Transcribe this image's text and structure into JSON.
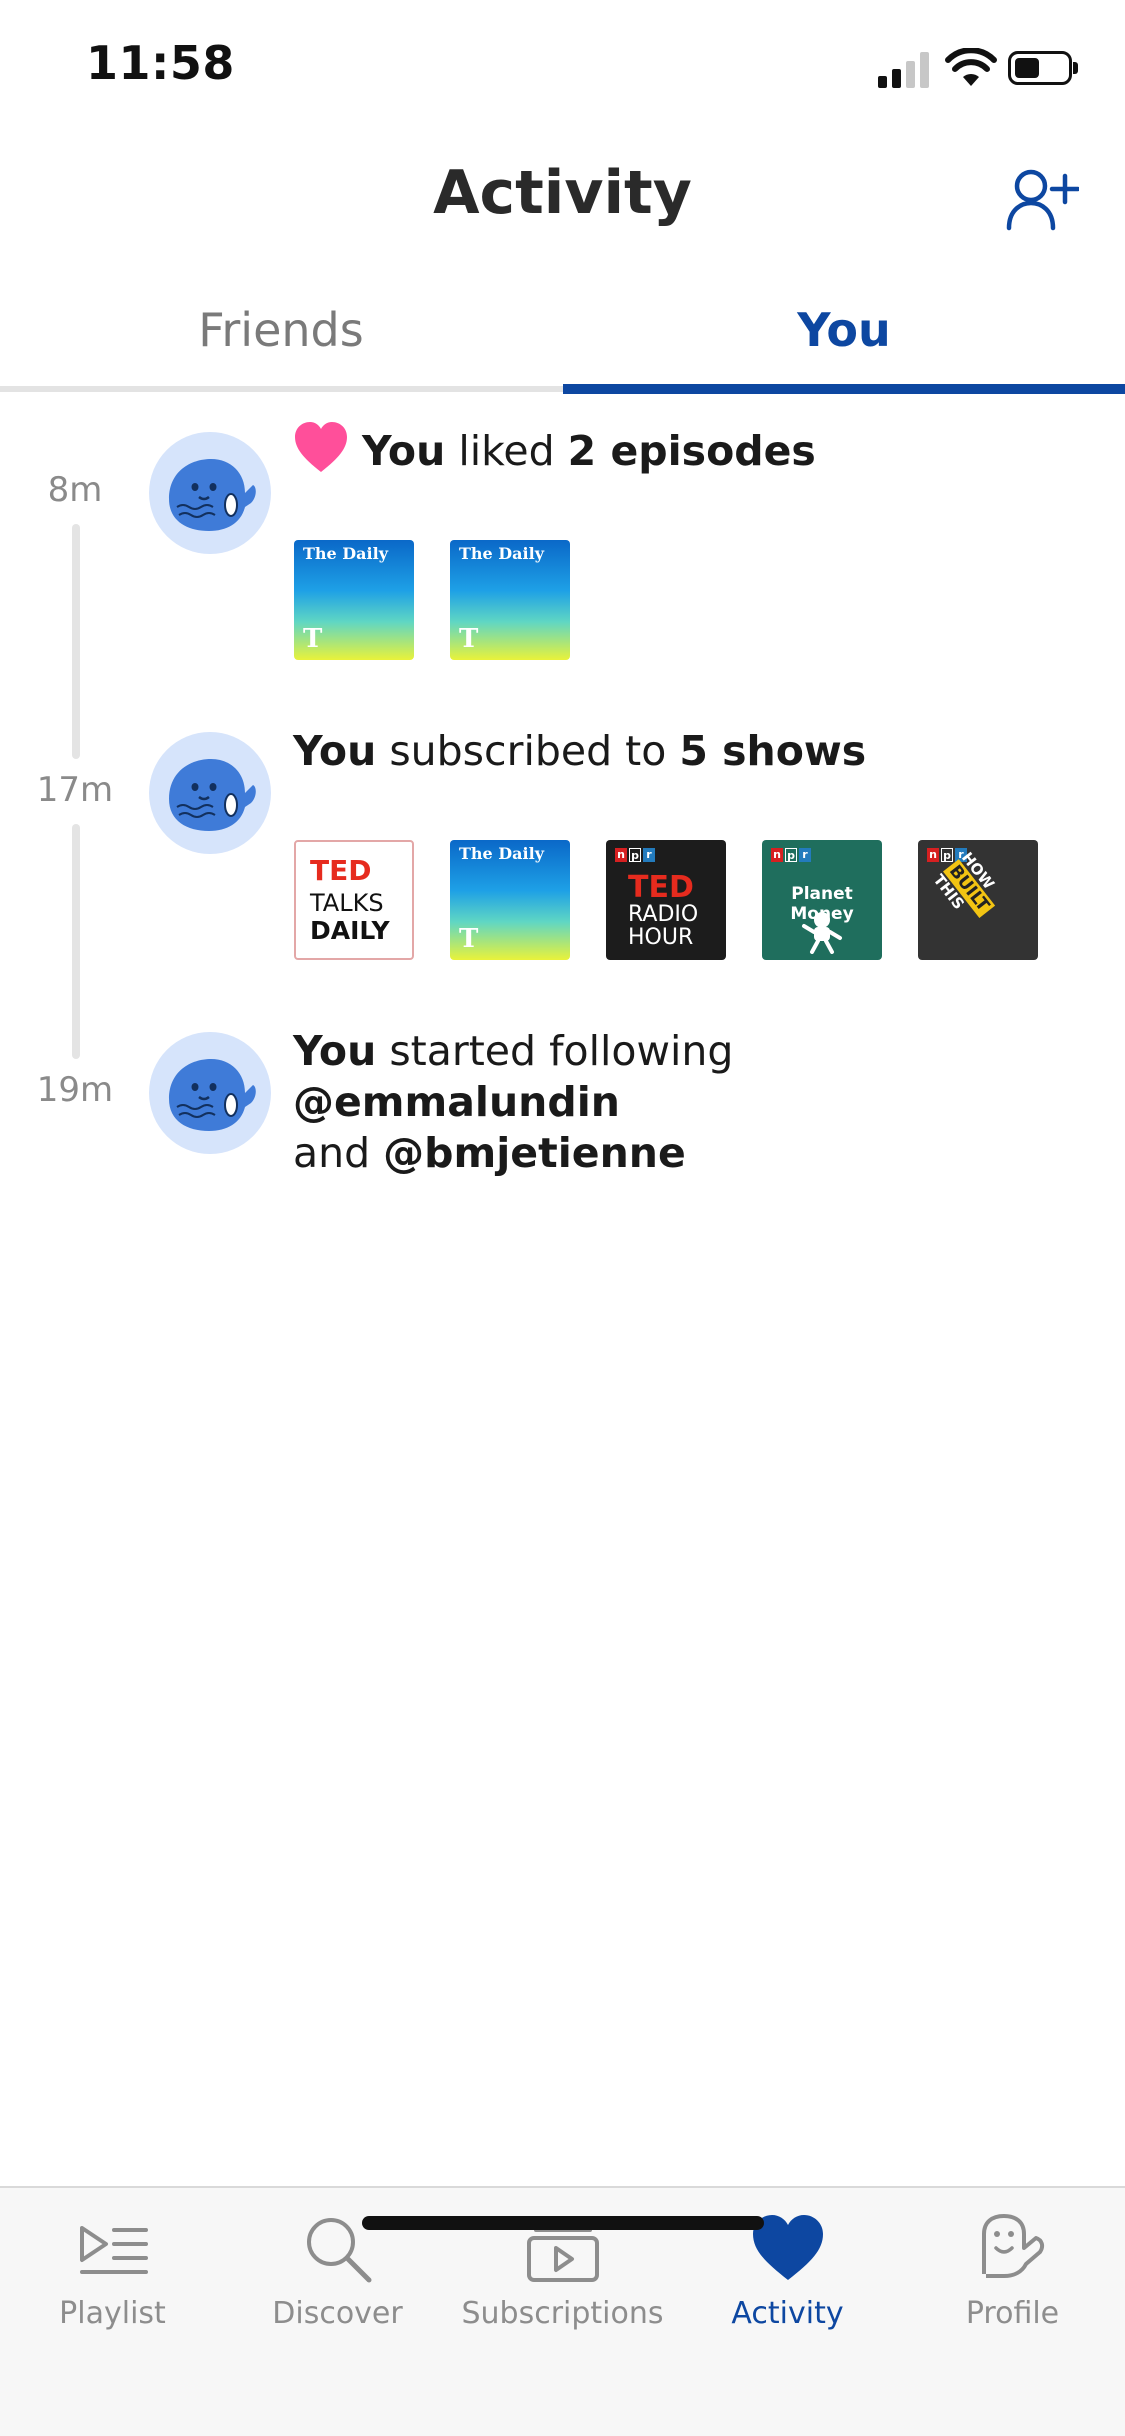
{
  "status_bar": {
    "time": "11:58"
  },
  "header": {
    "title": "Activity"
  },
  "tabs": [
    {
      "label": "Friends",
      "active": false
    },
    {
      "label": "You",
      "active": true
    }
  ],
  "feed": [
    {
      "time": "8m",
      "parts": {
        "subject": "You",
        "verb": " liked ",
        "object": "2 episodes"
      },
      "thumbnails": [
        {
          "show": "The Daily",
          "label": "The Daily",
          "logo": "T"
        },
        {
          "show": "The Daily",
          "label": "The Daily",
          "logo": "T"
        }
      ]
    },
    {
      "time": "17m",
      "parts": {
        "subject": "You",
        "verb": " subscribed to ",
        "object": "5 shows"
      },
      "thumbnails": [
        {
          "show": "TED Talks Daily",
          "l1": "TED",
          "l2": "TALKS",
          "l3": "DAILY"
        },
        {
          "show": "The Daily",
          "label": "The Daily",
          "logo": "T"
        },
        {
          "show": "TED Radio Hour",
          "badge": [
            "n",
            "p",
            "r"
          ],
          "l1": "TED",
          "l2": "RADIO",
          "l3": "HOUR"
        },
        {
          "show": "Planet Money",
          "badge": [
            "n",
            "p",
            "r"
          ],
          "label": "Planet Money"
        },
        {
          "show": "How I Built This",
          "badge": [
            "n",
            "p",
            "r"
          ],
          "w1": "HOW",
          "y1": "BUILT",
          "w2": "THIS"
        }
      ]
    },
    {
      "time": "19m",
      "parts": {
        "subject": "You",
        "verb": " started following ",
        "handle1": "@emmalundin",
        "and": "and ",
        "handle2": "@bmjetienne"
      }
    }
  ],
  "bottom_nav": [
    {
      "label": "Playlist",
      "icon": "playlist-icon",
      "active": false
    },
    {
      "label": "Discover",
      "icon": "search-icon",
      "active": false
    },
    {
      "label": "Subscriptions",
      "icon": "subscriptions-icon",
      "active": false
    },
    {
      "label": "Activity",
      "icon": "heart-icon",
      "active": true
    },
    {
      "label": "Profile",
      "icon": "whale-profile-icon",
      "active": false
    }
  ],
  "colors": {
    "accent": "#0d47a1",
    "inactive": "#8d8d8d",
    "avatar_bg": "#d6e4fb",
    "heart_pink": "#ff4f9a"
  }
}
